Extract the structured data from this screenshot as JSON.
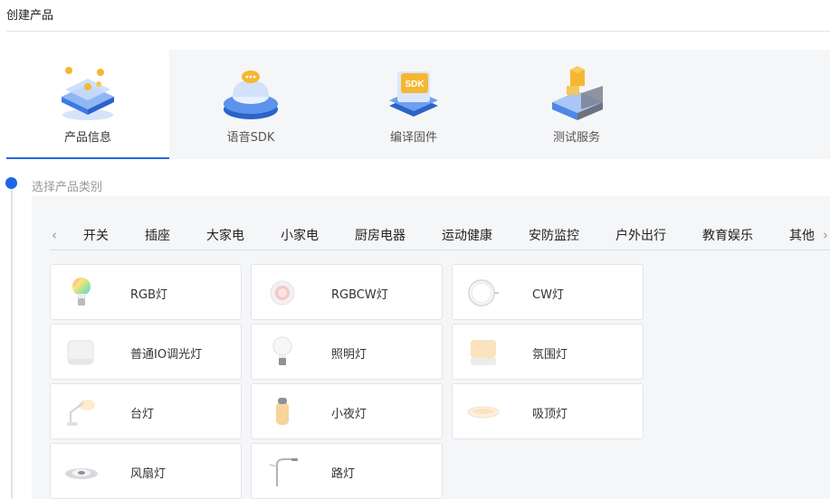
{
  "page": {
    "title": "创建产品"
  },
  "steps": [
    {
      "label": "产品信息",
      "icon": "product-info-illustration"
    },
    {
      "label": "语音SDK",
      "icon": "voice-sdk-illustration"
    },
    {
      "label": "编译固件",
      "icon": "compile-firmware-illustration"
    },
    {
      "label": "测试服务",
      "icon": "test-service-illustration"
    }
  ],
  "section": {
    "label": "选择产品类别"
  },
  "tabs": [
    "开关",
    "插座",
    "大家电",
    "小家电",
    "厨房电器",
    "运动健康",
    "安防监控",
    "户外出行",
    "教育娱乐",
    "其他"
  ],
  "tab_arrows": {
    "prev": "‹",
    "next": "›"
  },
  "products": [
    {
      "name": "RGB灯",
      "icon": "rgb-bulb-icon"
    },
    {
      "name": "RGBCW灯",
      "icon": "rgbcw-light-icon"
    },
    {
      "name": "CW灯",
      "icon": "cw-light-icon"
    },
    {
      "name": "普通IO调光灯",
      "icon": "io-dimmer-light-icon"
    },
    {
      "name": "照明灯",
      "icon": "lighting-bulb-icon"
    },
    {
      "name": "氛围灯",
      "icon": "ambient-light-icon"
    },
    {
      "name": "台灯",
      "icon": "desk-lamp-icon"
    },
    {
      "name": "小夜灯",
      "icon": "night-light-icon"
    },
    {
      "name": "吸顶灯",
      "icon": "ceiling-light-icon"
    },
    {
      "name": "风扇灯",
      "icon": "fan-light-icon"
    },
    {
      "name": "路灯",
      "icon": "street-light-icon"
    }
  ],
  "colors": {
    "accent": "#1f66e6",
    "panel_bg": "#f5f6f8"
  }
}
